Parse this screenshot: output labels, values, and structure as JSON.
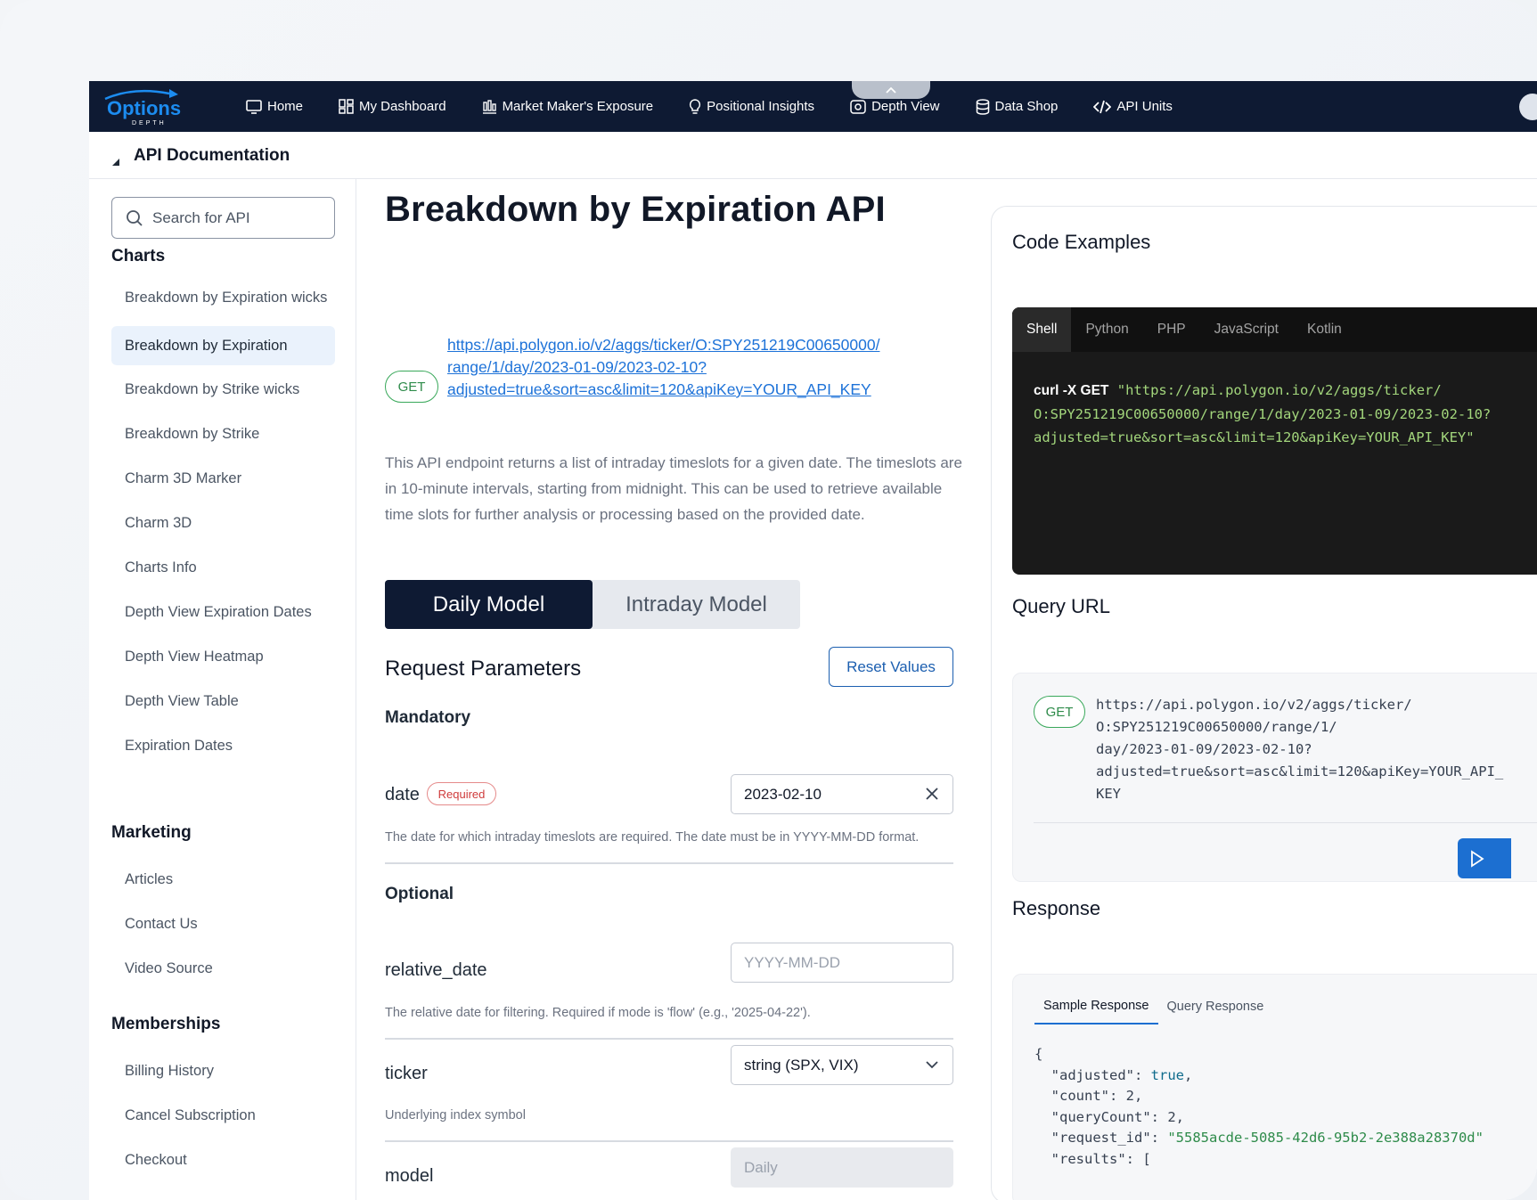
{
  "nav": {
    "logo_text": "Options",
    "logo_sub": "DEPTH",
    "items": [
      {
        "label": "Home",
        "icon": "monitor-icon"
      },
      {
        "label": "My Dashboard",
        "icon": "dashboard-icon"
      },
      {
        "label": "Market Maker's Exposure",
        "icon": "bar-chart-icon"
      },
      {
        "label": "Positional Insights",
        "icon": "lightbulb-icon"
      },
      {
        "label": "Depth View",
        "icon": "eye-icon"
      },
      {
        "label": "Data Shop",
        "icon": "database-icon"
      },
      {
        "label": "API Units",
        "icon": "code-icon"
      }
    ]
  },
  "subheader": {
    "title": "API Documentation"
  },
  "sidebar": {
    "search_placeholder": "Search for API",
    "sections": [
      {
        "title": "Charts",
        "items": [
          "Breakdown by Expiration wicks",
          "Breakdown by Expiration",
          "Breakdown by Strike wicks",
          "Breakdown by Strike",
          "Charm 3D Marker",
          "Charm 3D",
          "Charts Info",
          "Depth View Expiration Dates",
          "Depth View Heatmap",
          "Depth View Table",
          "Expiration Dates"
        ]
      },
      {
        "title": "Marketing",
        "items": [
          "Articles",
          "Contact Us",
          "Video Source"
        ]
      },
      {
        "title": "Memberships",
        "items": [
          "Billing History",
          "Cancel Subscription",
          "Checkout"
        ]
      }
    ],
    "active_item": "Breakdown by Expiration"
  },
  "main": {
    "title": "Breakdown by Expiration API",
    "method": "GET",
    "endpoint": "https://api.polygon.io/v2/aggs/ticker/O:SPY251219C00650000/range/1/day/2023-01-09/2023-02-10?adjusted=true&sort=asc&limit=120&apiKey=YOUR_API_KEY",
    "endpoint_lines": [
      "https://api.polygon.io/v2/aggs/ticker/O:SPY251219C00650000/",
      "range/1/day/2023-01-09/2023-02-10?",
      "adjusted=true&sort=asc&limit=120&apiKey=YOUR_API_KEY"
    ],
    "description": "This API endpoint returns a list of intraday timeslots for a given date. The timeslots are in 10-minute intervals, starting from midnight. This can be used to retrieve available time slots for further analysis or processing based on the provided date.",
    "model_tabs": [
      "Daily Model",
      "Intraday Model"
    ],
    "active_model": "Daily Model",
    "request_title": "Request Parameters",
    "reset_label": "Reset Values",
    "mandatory_label": "Mandatory",
    "optional_label": "Optional",
    "params": {
      "date": {
        "name": "date",
        "badge": "Required",
        "value": "2023-02-10",
        "help": "The date for which intraday timeslots are required. The date must be in YYYY-MM-DD format."
      },
      "relative_date": {
        "name": "relative_date",
        "placeholder": "YYYY-MM-DD",
        "help": "The relative date for filtering. Required if mode is 'flow' (e.g., '2025-04-22')."
      },
      "ticker": {
        "name": "ticker",
        "value": "string (SPX, VIX)",
        "help": "Underlying index symbol"
      },
      "model": {
        "name": "model",
        "value": "Daily"
      }
    }
  },
  "code_examples": {
    "title": "Code Examples",
    "tabs": [
      "Shell",
      "Python",
      "PHP",
      "JavaScript",
      "Kotlin"
    ],
    "active_tab": "Shell",
    "command": "curl -X GET",
    "line1": "\"https://api.polygon.io/v2/aggs/ticker/",
    "line2": "O:SPY251219C00650000/range/1/day/2023-01-09/2023-02-10?",
    "line3": "adjusted=true&sort=asc&limit=120&apiKey=YOUR_API_KEY\""
  },
  "query_url": {
    "title": "Query URL",
    "method": "GET",
    "text": "https://api.polygon.io/v2/aggs/ticker/\nO:SPY251219C00650000/range/1/\nday/2023-01-09/2023-02-10?\nadjusted=true&sort=asc&limit=120&apiKey=YOUR_API_\nKEY"
  },
  "response": {
    "title": "Response",
    "tabs": [
      "Sample Response",
      "Query Response"
    ],
    "active_tab": "Sample Response",
    "json_open": "{",
    "fields": [
      {
        "key": "\"adjusted\"",
        "value": "true",
        "type": "bool"
      },
      {
        "key": "\"count\"",
        "value": "2",
        "type": "num"
      },
      {
        "key": "\"queryCount\"",
        "value": "2",
        "type": "num"
      },
      {
        "key": "\"request_id\"",
        "value": "\"5585acde-5085-42d6-95b2-2e388a28370d\"",
        "type": "str"
      },
      {
        "key": "\"results\"",
        "value": "[",
        "type": "num"
      }
    ]
  },
  "colors": {
    "nav_bg": "#0e1a33",
    "accent": "#1c6fd1",
    "get_green": "#39a85a",
    "required_red": "#cf3b3b"
  }
}
